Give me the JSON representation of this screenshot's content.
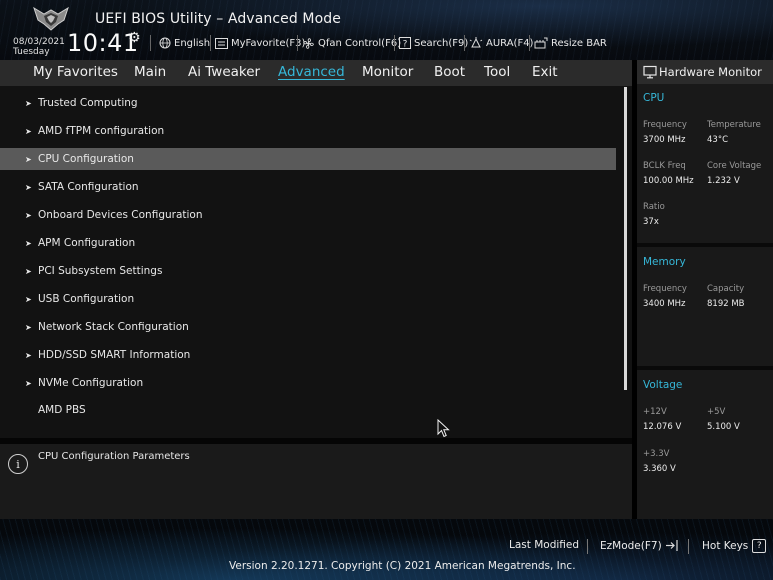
{
  "header": {
    "title": "UEFI BIOS Utility – Advanced Mode",
    "date": "08/03/2021",
    "weekday": "Tuesday",
    "time": "10:41",
    "toolbar": [
      {
        "label": "English",
        "icon": "globe-icon"
      },
      {
        "label": "MyFavorite(F3)",
        "icon": "favorite-icon"
      },
      {
        "label": "Qfan Control(F6)",
        "icon": "fan-icon"
      },
      {
        "label": "Search(F9)",
        "icon": "search-help-icon"
      },
      {
        "label": "AURA(F4)",
        "icon": "aura-icon"
      },
      {
        "label": "Resize BAR",
        "icon": "resize-bar-icon"
      }
    ]
  },
  "nav": {
    "tabs": [
      "My Favorites",
      "Main",
      "Ai Tweaker",
      "Advanced",
      "Monitor",
      "Boot",
      "Tool",
      "Exit"
    ],
    "active": "Advanced"
  },
  "menu": {
    "items": [
      {
        "label": "Trusted Computing",
        "submenu": true
      },
      {
        "label": "AMD fTPM configuration",
        "submenu": true
      },
      {
        "label": "CPU Configuration",
        "submenu": true,
        "selected": true
      },
      {
        "label": "SATA Configuration",
        "submenu": true
      },
      {
        "label": "Onboard Devices Configuration",
        "submenu": true
      },
      {
        "label": "APM Configuration",
        "submenu": true
      },
      {
        "label": "PCI Subsystem Settings",
        "submenu": true
      },
      {
        "label": "USB Configuration",
        "submenu": true
      },
      {
        "label": "Network Stack Configuration",
        "submenu": true
      },
      {
        "label": "HDD/SSD SMART Information",
        "submenu": true
      },
      {
        "label": "NVMe Configuration",
        "submenu": true
      },
      {
        "label": "AMD PBS",
        "submenu": false
      }
    ]
  },
  "help": {
    "text": "CPU Configuration Parameters"
  },
  "hardware_monitor": {
    "title": "Hardware Monitor",
    "cpu": {
      "heading": "CPU",
      "frequency_label": "Frequency",
      "frequency": "3700 MHz",
      "temperature_label": "Temperature",
      "temperature": "43°C",
      "bclk_label": "BCLK Freq",
      "bclk": "100.00 MHz",
      "core_voltage_label": "Core Voltage",
      "core_voltage": "1.232 V",
      "ratio_label": "Ratio",
      "ratio": "37x"
    },
    "memory": {
      "heading": "Memory",
      "frequency_label": "Frequency",
      "frequency": "3400 MHz",
      "capacity_label": "Capacity",
      "capacity": "8192 MB"
    },
    "voltage": {
      "heading": "Voltage",
      "v12_label": "+12V",
      "v12": "12.076 V",
      "v5_label": "+5V",
      "v5": "5.100 V",
      "v33_label": "+3.3V",
      "v33": "3.360 V"
    }
  },
  "footer": {
    "last_modified": "Last Modified",
    "ezmode": "EzMode(F7)",
    "hotkeys": "Hot Keys",
    "copyright": "Version 2.20.1271. Copyright (C) 2021 American Megatrends, Inc."
  },
  "colors": {
    "accent": "#36b7d8",
    "selected_row": "#5a5a5a",
    "nav_bar": "#2b2b2b"
  }
}
